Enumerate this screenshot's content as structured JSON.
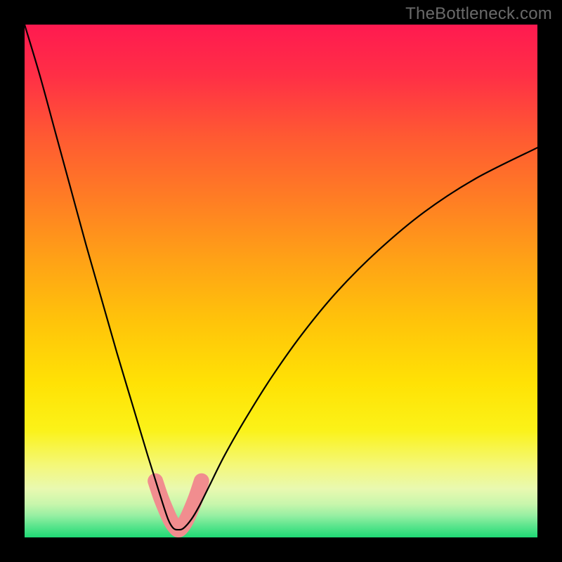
{
  "watermark": "TheBottleneck.com",
  "gradient": {
    "stops": [
      {
        "offset": 0.0,
        "color": "#ff1a50"
      },
      {
        "offset": 0.1,
        "color": "#ff2f46"
      },
      {
        "offset": 0.22,
        "color": "#ff5a32"
      },
      {
        "offset": 0.34,
        "color": "#ff7d24"
      },
      {
        "offset": 0.46,
        "color": "#ffa216"
      },
      {
        "offset": 0.58,
        "color": "#ffc40a"
      },
      {
        "offset": 0.7,
        "color": "#ffe205"
      },
      {
        "offset": 0.79,
        "color": "#fbf218"
      },
      {
        "offset": 0.86,
        "color": "#f4f87a"
      },
      {
        "offset": 0.905,
        "color": "#e9f9b0"
      },
      {
        "offset": 0.935,
        "color": "#c8f6ac"
      },
      {
        "offset": 0.958,
        "color": "#95efa2"
      },
      {
        "offset": 0.978,
        "color": "#5ae58d"
      },
      {
        "offset": 1.0,
        "color": "#1fd975"
      }
    ]
  },
  "chart_data": {
    "type": "line",
    "title": "",
    "xlabel": "",
    "ylabel": "",
    "xlim": [
      0,
      100
    ],
    "ylim": [
      0,
      100
    ],
    "series": [
      {
        "name": "bottleneck-curve",
        "x": [
          0,
          3,
          6,
          9,
          12,
          15,
          18,
          21,
          24,
          26.5,
          28,
          29,
          30,
          31,
          32.5,
          34,
          36,
          39,
          43,
          48,
          54,
          61,
          69,
          78,
          88,
          100
        ],
        "values": [
          100,
          90,
          79,
          68,
          57,
          46.5,
          36,
          26,
          16,
          8,
          3.5,
          1.8,
          1.5,
          1.8,
          3.5,
          6,
          10,
          16,
          23,
          31,
          39.5,
          48,
          56,
          63.5,
          70,
          76
        ]
      }
    ],
    "highlight": {
      "name": "pink-bottom-band",
      "color": "#f18d8f",
      "x": [
        25.5,
        26.5,
        27.5,
        28.4,
        29.2,
        30,
        30.8,
        31.6,
        32.5,
        33.5,
        34.5
      ],
      "values": [
        11,
        8,
        5.5,
        3.5,
        2.2,
        1.5,
        2.2,
        3.5,
        5.5,
        8,
        11
      ]
    }
  }
}
